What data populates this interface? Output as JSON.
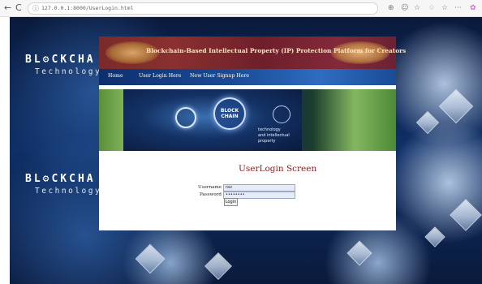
{
  "browser": {
    "back": "←",
    "refresh": "C",
    "url": "127.0.0.1:8000/UserLogin.html",
    "toolbar_icons": [
      "⊕",
      "☺",
      "☆",
      "♢",
      "☆",
      "···"
    ]
  },
  "background": {
    "logo_top": "BL⚙CKCHA",
    "logo_top_sub": "Technology",
    "logo_bottom": "BL⚙CKCHA",
    "logo_bottom_sub": "Technology"
  },
  "header": {
    "title": "Blockchain-Based Intellectual Property (IP) Protection Platform for Creators"
  },
  "menu": {
    "items": [
      {
        "label": "Home"
      },
      {
        "label": "User Login Here"
      },
      {
        "label": "New User Signup Here"
      }
    ]
  },
  "hero": {
    "block_line1": "BLOCK",
    "block_line2": "CHAIN",
    "caption_line1": "technology",
    "caption_line2": "and intellectual property"
  },
  "login": {
    "title": "UserLogin Screen",
    "username_label": "Username",
    "username_value": "rav",
    "password_label": "Password",
    "password_value": "••••••••",
    "button_label": "Login"
  },
  "colors": {
    "banner": "#7a2a2a",
    "menu": "#1a4b96",
    "login_title": "#8b1d1d",
    "input_bg": "#e6ecf7"
  }
}
